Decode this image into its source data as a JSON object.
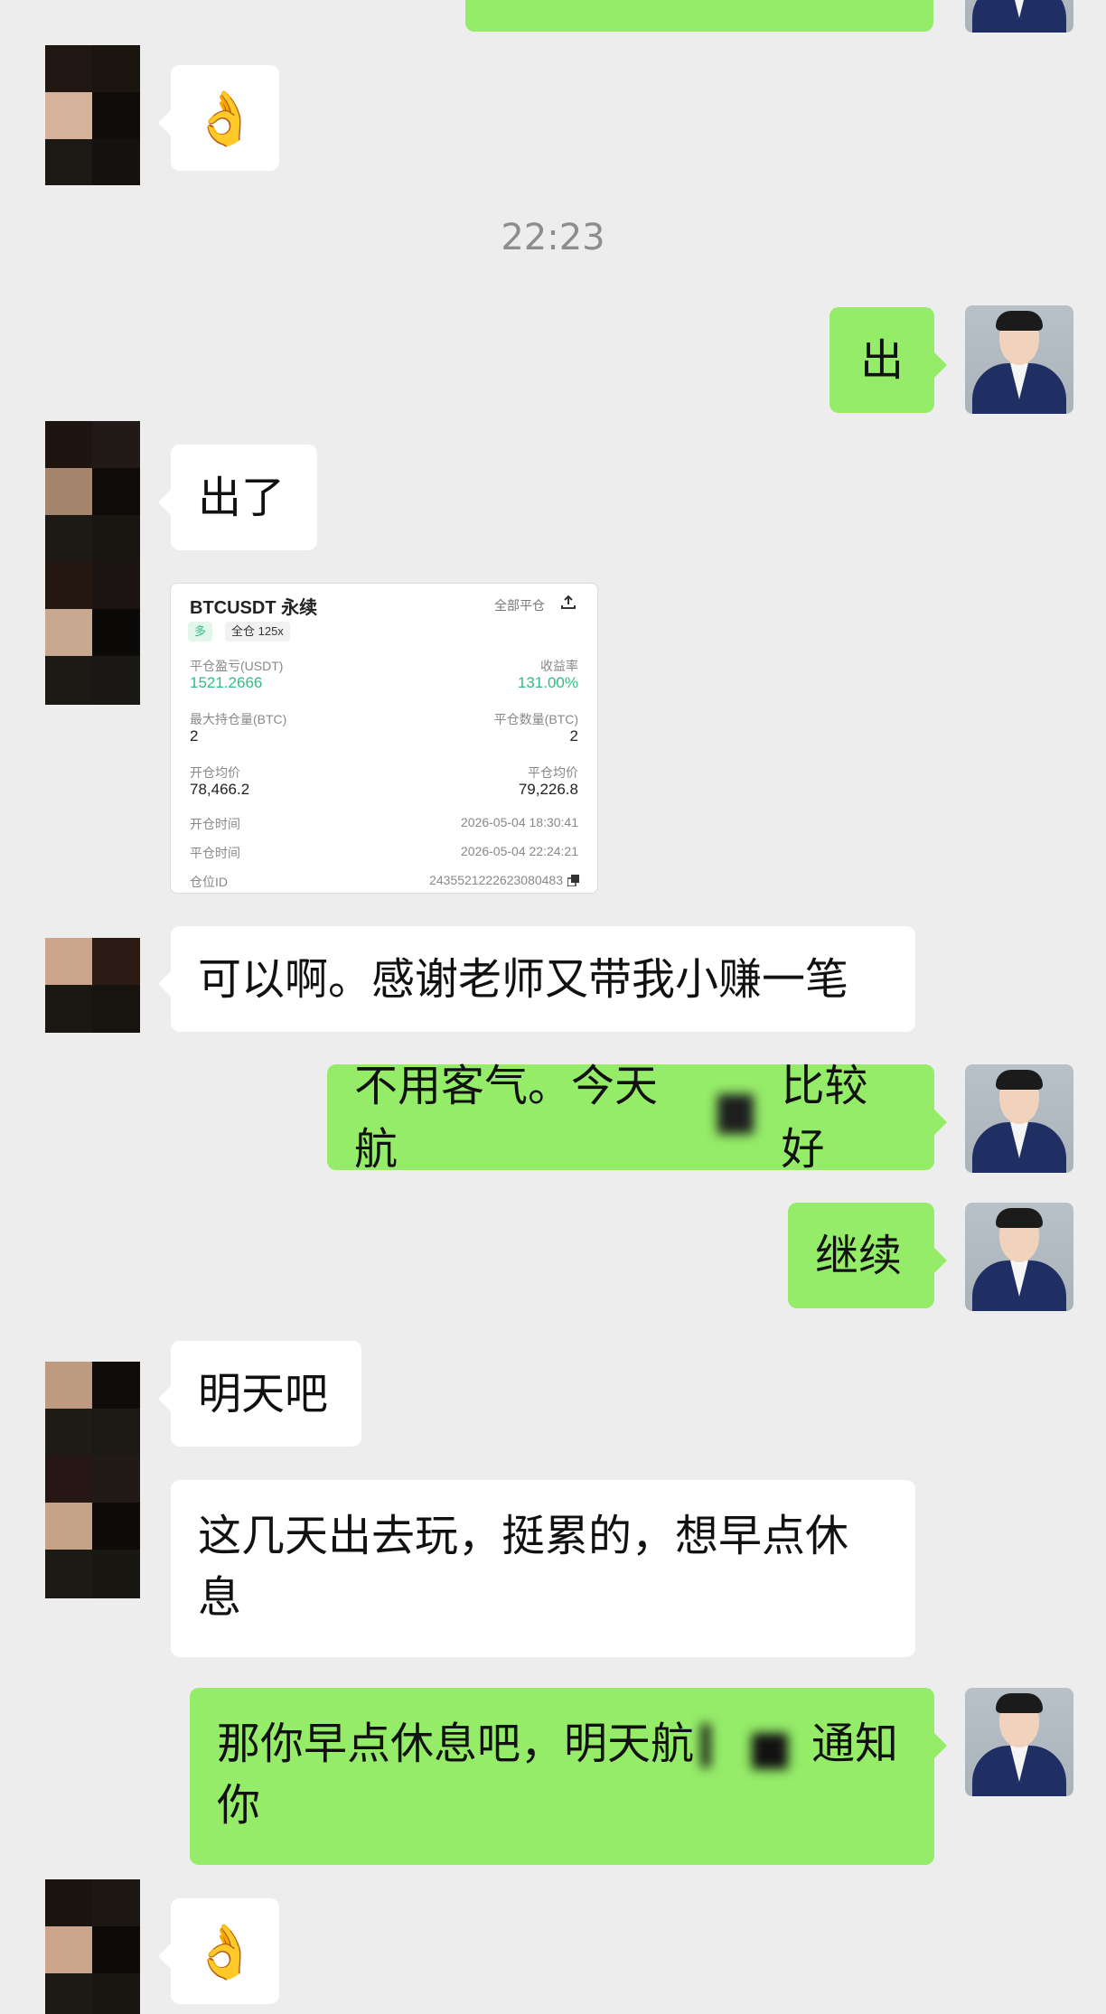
{
  "theme": {
    "incoming_bubble": "#ffffff",
    "outgoing_bubble": "#95ec69",
    "background": "#ededed"
  },
  "timestamp": "22:23",
  "messages": [
    {
      "side": "in",
      "text": "👌"
    },
    {
      "side": "out",
      "text": "出"
    },
    {
      "side": "in",
      "text": "出了"
    },
    {
      "side": "in",
      "type": "image",
      "card": {
        "title": "BTCUSDT 永续",
        "close_all": "全部平仓",
        "share_icon": "share-icon",
        "tag_long": "多",
        "tag_margin": "全仓 125x",
        "pnl_label": "平仓盈亏(USDT)",
        "pnl_value": "1521.2666",
        "roi_label": "收益率",
        "roi_value": "131.00%",
        "max_pos_label": "最大持仓量(BTC)",
        "max_pos_value": "2",
        "close_qty_label": "平仓数量(BTC)",
        "close_qty_value": "2",
        "open_avg_label": "开仓均价",
        "open_avg_value": "78,466.2",
        "close_avg_label": "平仓均价",
        "close_avg_value": "79,226.8",
        "open_time_label": "开仓时间",
        "open_time_value": "2026-05-04 18:30:41",
        "close_time_label": "平仓时间",
        "close_time_value": "2026-05-04 22:24:21",
        "position_id_label": "仓位ID",
        "position_id_value": "2435521222623080483",
        "copy_icon": "copy-icon"
      }
    },
    {
      "side": "in",
      "text": "可以啊。感谢老师又带我小赚一笔"
    },
    {
      "side": "out",
      "text_a": "不用客气。今天航",
      "text_b": "比较好"
    },
    {
      "side": "out",
      "text": "继续"
    },
    {
      "side": "in",
      "text": "明天吧"
    },
    {
      "side": "in",
      "line1": "这几天出去玩，挺累的，想早点休",
      "line2": "息"
    },
    {
      "side": "out",
      "line1_a": "那你早点休息吧，明天航",
      "line1_b": "通知",
      "line2": "你"
    },
    {
      "side": "in",
      "text": "👌"
    }
  ]
}
